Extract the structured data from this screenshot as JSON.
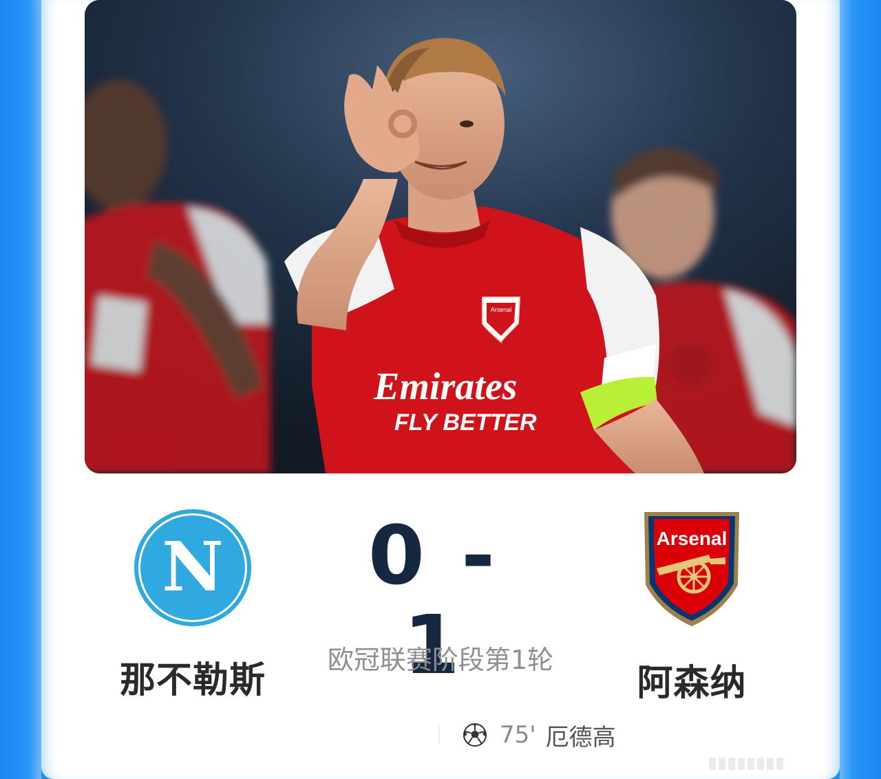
{
  "match": {
    "home_team": "那不勒斯",
    "away_team": "阿森纳",
    "home_score": "0",
    "separator": "-",
    "away_score": "1",
    "stage": "欧冠联赛阶段第1轮",
    "home_logo_letter": "N",
    "away_logo_text": "Arsenal"
  },
  "photo": {
    "jersey_sponsor_line1": "Emirates",
    "jersey_sponsor_line2": "FLY BETTER",
    "crest_text": "Arsenal"
  },
  "goals": [
    {
      "icon": "soccer-ball-icon",
      "minute": "75'",
      "scorer": "厄德高"
    }
  ],
  "colors": {
    "page_blue": "#1f8ef5",
    "score_navy": "#152840",
    "napoli_blue": "#2fa9e0",
    "arsenal_red": "#db0007",
    "arsenal_gold": "#9c824a",
    "arsenal_navy": "#063672"
  }
}
